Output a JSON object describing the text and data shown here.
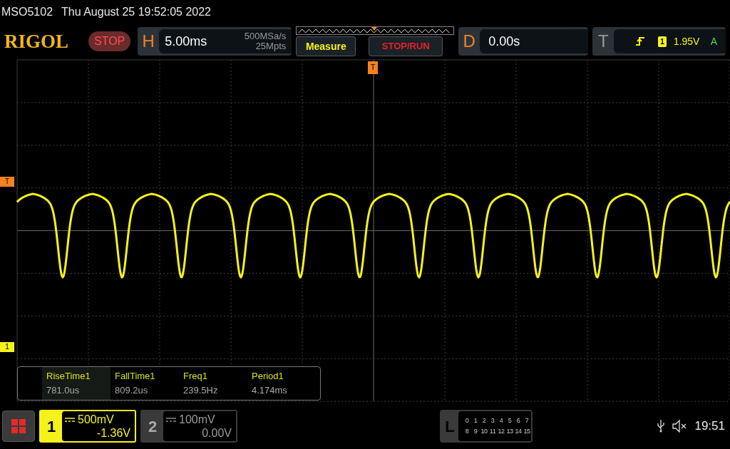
{
  "title_bar": {
    "model": "MSO5102",
    "datetime": "Thu August 25 19:52:05 2022"
  },
  "toolbar": {
    "logo": "RIGOL",
    "run_state": "STOP",
    "horizontal": {
      "label": "H",
      "timebase": "5.00ms",
      "sample_rate": "500MSa/s",
      "memory_depth": "25Mpts"
    },
    "buttons": [
      "Measure",
      "STOP/RUN"
    ],
    "delay": {
      "label": "D",
      "value": "0.00s"
    },
    "trigger": {
      "label": "T",
      "source": "1",
      "level": "1.95V",
      "mode": "A"
    }
  },
  "markers": {
    "trigger_position": "T",
    "trigger_level": "T",
    "channel": "1"
  },
  "measurements": [
    {
      "name": "RiseTime1",
      "value": "781.0us",
      "selected": true
    },
    {
      "name": "FallTime1",
      "value": "809.2us",
      "selected": false
    },
    {
      "name": "Freq1",
      "value": "239.5Hz",
      "selected": false
    },
    {
      "name": "Period1",
      "value": "4.174ms",
      "selected": false
    }
  ],
  "channels": [
    {
      "number": "1",
      "scale": "500mV",
      "offset": "-1.36V",
      "selected": true
    },
    {
      "number": "2",
      "scale": "100mV",
      "offset": "0.00V",
      "selected": false
    }
  ],
  "logic": {
    "label": "L",
    "rows": [
      [
        "0",
        "1",
        "2",
        "3",
        "4",
        "5",
        "6",
        "7"
      ],
      [
        "8",
        "9",
        "10",
        "11",
        "12",
        "13",
        "14",
        "15"
      ]
    ]
  },
  "status": {
    "time": "19:51"
  }
}
